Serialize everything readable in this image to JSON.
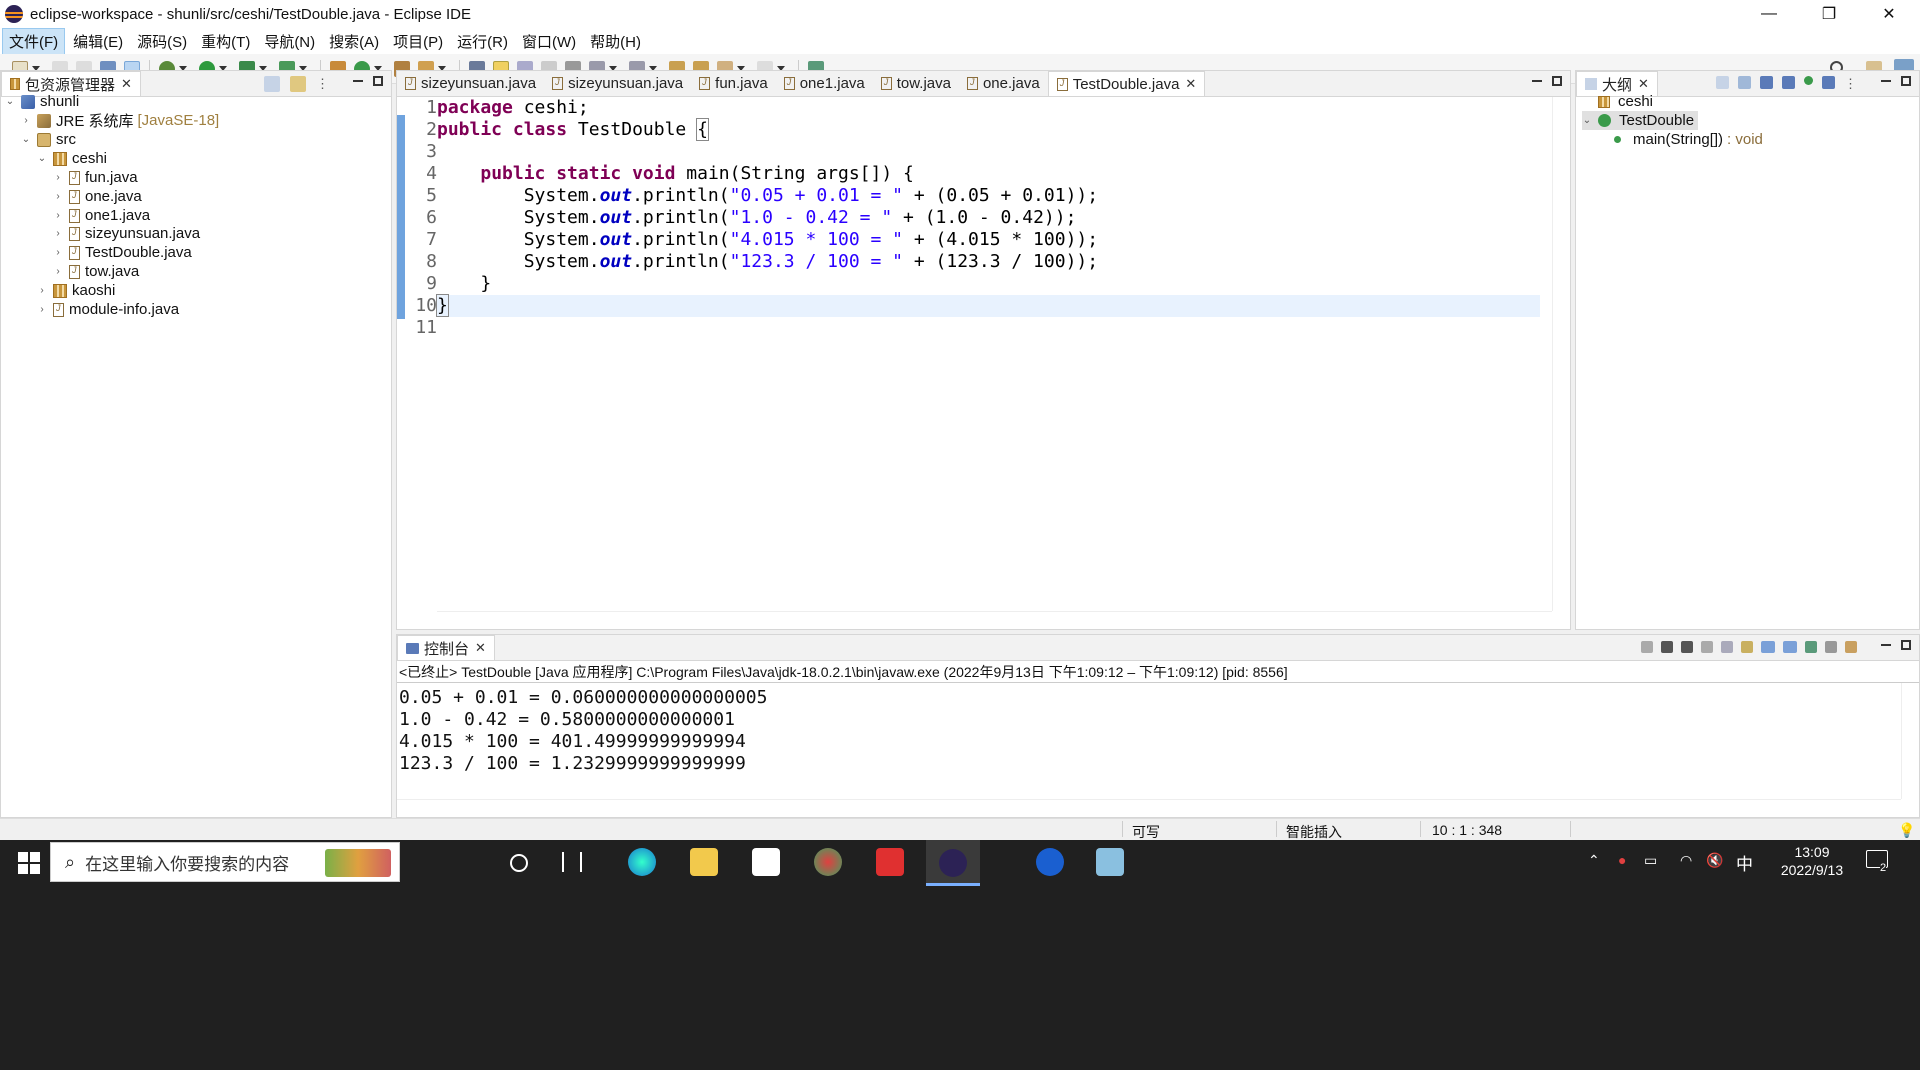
{
  "window": {
    "title": "eclipse-workspace - shunli/src/ceshi/TestDouble.java - Eclipse IDE",
    "minimize": "—",
    "restore": "❐",
    "close": "✕"
  },
  "menu": [
    "文件(F)",
    "编辑(E)",
    "源码(S)",
    "重构(T)",
    "导航(N)",
    "搜索(A)",
    "项目(P)",
    "运行(R)",
    "窗口(W)",
    "帮助(H)"
  ],
  "explorer": {
    "title": "包资源管理器",
    "tree": [
      {
        "label": "shunli",
        "decor": ""
      },
      {
        "label": "JRE 系统库",
        "decor": "[JavaSE-18]"
      },
      {
        "label": "src",
        "decor": ""
      },
      {
        "label": "ceshi",
        "decor": ""
      },
      {
        "label": "fun.java",
        "decor": ""
      },
      {
        "label": "one.java",
        "decor": ""
      },
      {
        "label": "one1.java",
        "decor": ""
      },
      {
        "label": "sizeyunsuan.java",
        "decor": ""
      },
      {
        "label": "TestDouble.java",
        "decor": ""
      },
      {
        "label": "tow.java",
        "decor": ""
      },
      {
        "label": "kaoshi",
        "decor": ""
      },
      {
        "label": "module-info.java",
        "decor": ""
      }
    ]
  },
  "editor": {
    "tabs": [
      "sizeyunsuan.java",
      "sizeyunsuan.java",
      "fun.java",
      "one1.java",
      "tow.java",
      "one.java",
      "TestDouble.java"
    ],
    "line_numbers": [
      "1",
      "2",
      "3",
      "4",
      "5",
      "6",
      "7",
      "8",
      "9",
      "10",
      "11"
    ],
    "code": {
      "l1_kw": "package",
      "l1_rest": " ceshi;",
      "l2_kw": "public class",
      "l2_name": " TestDouble ",
      "l2_brace": "{",
      "l4_indent": "    ",
      "l4_kw": "public static void",
      "l4_rest": " main(String args[]) {",
      "sys": "        System.",
      "out": "out",
      "println": ".println(",
      "l5_str": "\"0.05 + 0.01 = \"",
      "l5_rest": " + (0.05 + 0.01));",
      "l6_str": "\"1.0 - 0.42 = \"",
      "l6_rest": " + (1.0 - 0.42));",
      "l7_str": "\"4.015 * 100 = \"",
      "l7_rest": " + (4.015 * 100));",
      "l8_str": "\"123.3 / 100 = \"",
      "l8_rest": " + (123.3 / 100));",
      "l9": "    }",
      "l10": "}"
    }
  },
  "outline": {
    "title": "大纲",
    "items": [
      "ceshi",
      "TestDouble",
      "main(String[])",
      ": void"
    ]
  },
  "console": {
    "title": "控制台",
    "header": "<已终止> TestDouble [Java 应用程序] C:\\Program Files\\Java\\jdk-18.0.2.1\\bin\\javaw.exe  (2022年9月13日 下午1:09:12 – 下午1:09:12) [pid: 8556]",
    "output": [
      "0.05 + 0.01 = 0.060000000000000005",
      "1.0 - 0.42 = 0.5800000000000001",
      "4.015 * 100 = 401.49999999999994",
      "123.3 / 100 = 1.2329999999999999"
    ]
  },
  "status": {
    "writable": "可写",
    "insert_mode": "智能插入",
    "position": "10 : 1 : 348"
  },
  "taskbar": {
    "search_placeholder": "在这里输入你要搜索的内容",
    "ime": "中",
    "time": "13:09",
    "date": "2022/9/13",
    "notifications": "2"
  }
}
